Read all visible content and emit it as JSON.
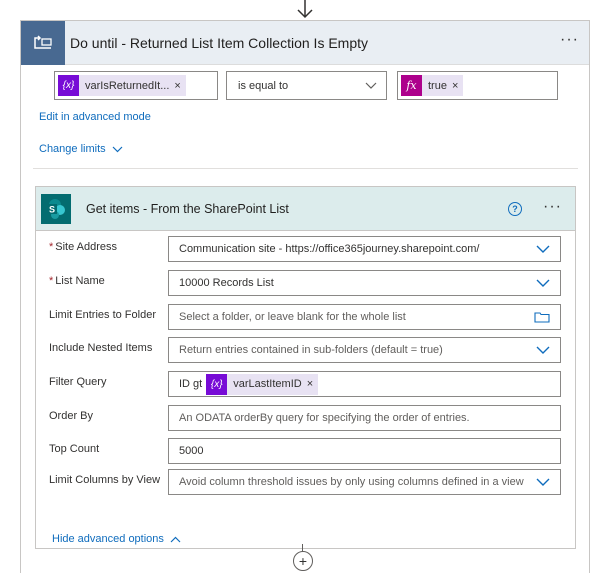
{
  "do_until": {
    "title": "Do until - Returned List Item Collection Is Empty",
    "more_label": "···",
    "condition": {
      "left_token": "varIsReturnedIt...",
      "left_token_icon": "{x}",
      "left_token_close": "×",
      "operator": "is equal to",
      "right_token": "true",
      "right_token_icon": "fx",
      "right_token_close": "×"
    },
    "edit_advanced_label": "Edit in advanced mode",
    "change_limits_label": "Change limits"
  },
  "get_items": {
    "title": "Get items - From the SharePoint List",
    "help_label": "?",
    "more_label": "···",
    "fields": {
      "site_address": {
        "label": "Site Address",
        "required_mark": "*",
        "value": "Communication site - https://office365journey.sharepoint.com/"
      },
      "list_name": {
        "label": "List Name",
        "required_mark": "*",
        "value": "10000 Records List"
      },
      "limit_folder": {
        "label": "Limit Entries to Folder",
        "placeholder": "Select a folder, or leave blank for the whole list"
      },
      "nested_items": {
        "label": "Include Nested Items",
        "placeholder": "Return entries contained in sub-folders (default = true)"
      },
      "filter_query": {
        "label": "Filter Query",
        "prefix": "ID gt",
        "token": "varLastItemID",
        "token_icon": "{x}",
        "token_close": "×"
      },
      "order_by": {
        "label": "Order By",
        "placeholder": "An ODATA orderBy query for specifying the order of entries."
      },
      "top_count": {
        "label": "Top Count",
        "value": "5000"
      },
      "limit_columns": {
        "label": "Limit Columns by View",
        "placeholder": "Avoid column threshold issues by only using columns defined in a view"
      }
    },
    "hide_advanced_label": "Hide advanced options"
  },
  "add_step_label": "+",
  "colors": {
    "do_until_accent": "#486991",
    "sharepoint_accent": "#036c70",
    "variable_token": "#770bd6",
    "expression_token": "#ad008c",
    "link": "#0f6cbd"
  },
  "icons": {
    "top_arrow": "arrow-down-icon",
    "do_until": "loop-icon",
    "sharepoint": "sharepoint-icon",
    "dropdown": "chevron-down-icon",
    "folder": "folder-icon",
    "collapse": "chevron-up-icon"
  }
}
